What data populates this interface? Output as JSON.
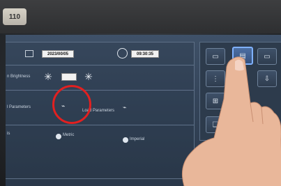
{
  "device": {
    "model_badge": "110"
  },
  "settings": {
    "date_value": "2023/00/05",
    "time_value": "09:30:35",
    "brightness_label": "n Brightness",
    "parameters_label_left": "l Parameters",
    "parameters_label_right": "Load Parameters",
    "units_label": "is",
    "unit_metric": "Metric",
    "unit_imperial": "Imperial",
    "selected_unit": "Metric"
  },
  "sidebar": {
    "icons": [
      "monitor-network-icon",
      "document-icon",
      "laptop-icon",
      "chart-icon",
      "network-icon",
      "download-icon",
      "layers-icon"
    ]
  },
  "colors": {
    "screen_bg": "#3f5168",
    "highlight_circle": "#e22020",
    "active_button": "#4d6fa3"
  }
}
